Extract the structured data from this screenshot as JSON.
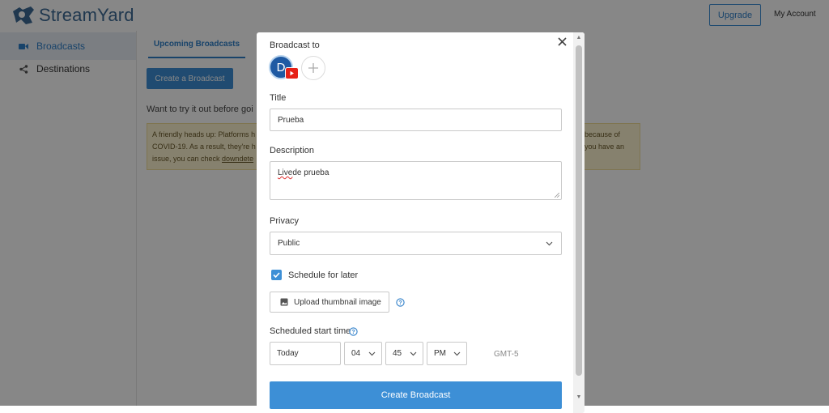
{
  "app": {
    "brand": "StreamYard",
    "upgrade_label": "Upgrade",
    "account_label": "My Account"
  },
  "sidebar": {
    "items": [
      {
        "label": "Broadcasts",
        "icon": "video-camera-icon",
        "active": true
      },
      {
        "label": "Destinations",
        "icon": "share-icon",
        "active": false
      }
    ]
  },
  "main": {
    "tab_label": "Upcoming Broadcasts",
    "create_label": "Create a Broadcast",
    "try_text": "Want to try it out before goi",
    "notice": {
      "line1_left": "A friendly heads up: Platforms h",
      "line2_left": "COVID-19. As a result, they're h",
      "line3_left": "issue, you can check ",
      "line3_link": "downdete",
      "line1_right": "because of",
      "line2_right": "you have an"
    }
  },
  "modal": {
    "broadcast_to_label": "Broadcast to",
    "avatar_initial": "D",
    "title_label": "Title",
    "title_value": "Prueba",
    "description_label": "Description",
    "description_word1": "Live",
    "description_rest": " de prueba",
    "privacy_label": "Privacy",
    "privacy_value": "Public",
    "schedule_label": "Schedule for later",
    "schedule_checked": true,
    "upload_label": "Upload thumbnail image",
    "start_time_label": "Scheduled start time",
    "date_value": "Today",
    "hour_value": "04",
    "minute_value": "45",
    "ampm_value": "PM",
    "timezone": "GMT-5",
    "submit_label": "Create Broadcast"
  },
  "colors": {
    "accent": "#3d8fd6",
    "brand_text": "#3d6b95",
    "youtube": "#e62117"
  }
}
